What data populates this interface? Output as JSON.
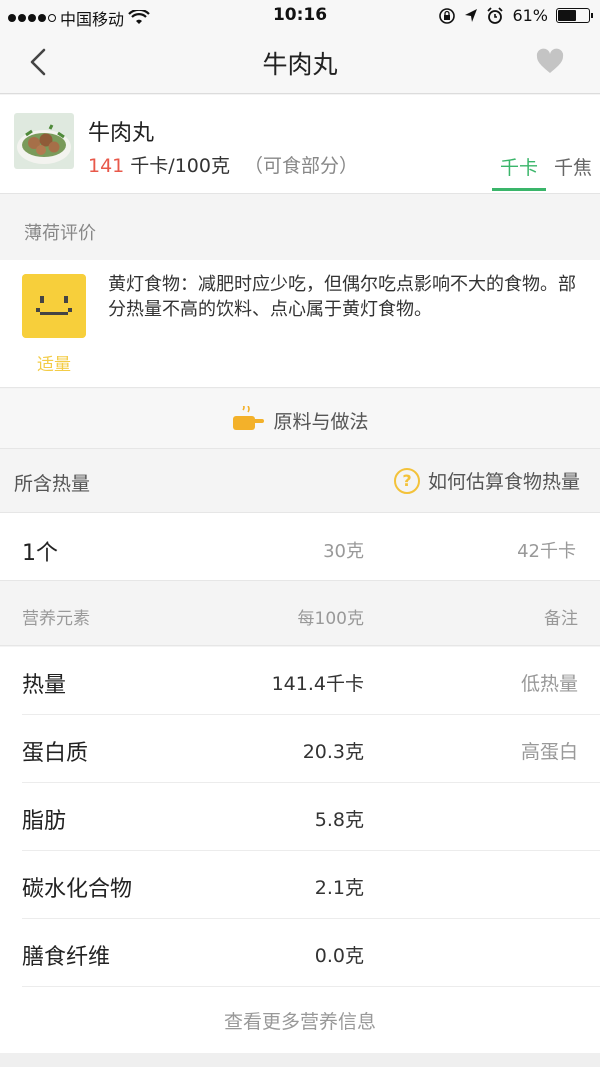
{
  "status_bar": {
    "carrier": "中国移动",
    "time": "10:16",
    "battery": "61%",
    "battery_level": 0.61
  },
  "nav": {
    "title": "牛肉丸",
    "back_icon": "chevron-left-icon",
    "favorite_icon": "heart-icon"
  },
  "food": {
    "name": "牛肉丸",
    "calorie_value": "141",
    "calorie_unit": " 千卡/100克",
    "calorie_note": "（可食部分）",
    "unit_tabs": [
      {
        "label": "千卡",
        "active": true
      },
      {
        "label": "千焦",
        "active": false
      }
    ]
  },
  "rating": {
    "section_title": "薄荷评价",
    "level_label": "适量",
    "description": "黄灯食物：减肥时应少吃，但偶尔吃点影响不大的食物。部分热量不高的饮料、点心属于黄灯食物。",
    "face_color": "#f7cf3b"
  },
  "recipe": {
    "label": "原料与做法",
    "icon": "pot-icon"
  },
  "calorie_section": {
    "title": "所含热量",
    "help_label": "如何估算食物热量",
    "help_icon": "question-icon",
    "portion": {
      "name": "1个",
      "weight": "30克",
      "calories": "42千卡"
    }
  },
  "nutrition": {
    "header": {
      "name": "营养元素",
      "per100": "每100克",
      "note": "备注"
    },
    "rows": [
      {
        "name": "热量",
        "value": "141.4千卡",
        "note": "低热量"
      },
      {
        "name": "蛋白质",
        "value": "20.3克",
        "note": "高蛋白"
      },
      {
        "name": "脂肪",
        "value": "5.8克",
        "note": ""
      },
      {
        "name": "碳水化合物",
        "value": "2.1克",
        "note": ""
      },
      {
        "name": "膳食纤维",
        "value": "0.0克",
        "note": ""
      }
    ],
    "more_label": "查看更多营养信息"
  },
  "colors": {
    "accent_green": "#3ab56a",
    "calorie_red": "#e8584a",
    "yellow": "#f7cf3b"
  }
}
